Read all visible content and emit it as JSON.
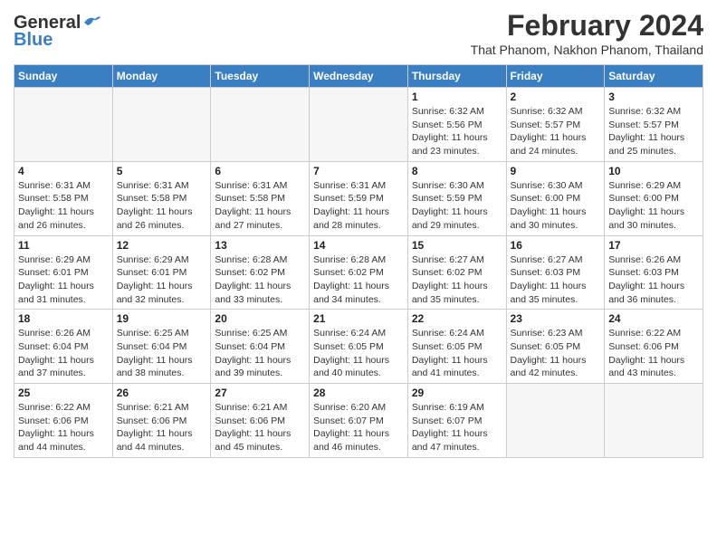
{
  "header": {
    "logo_general": "General",
    "logo_blue": "Blue",
    "title": "February 2024",
    "subtitle": "That Phanom, Nakhon Phanom, Thailand"
  },
  "days_of_week": [
    "Sunday",
    "Monday",
    "Tuesday",
    "Wednesday",
    "Thursday",
    "Friday",
    "Saturday"
  ],
  "weeks": [
    [
      {
        "day": "",
        "info": ""
      },
      {
        "day": "",
        "info": ""
      },
      {
        "day": "",
        "info": ""
      },
      {
        "day": "",
        "info": ""
      },
      {
        "day": "1",
        "info": "Sunrise: 6:32 AM\nSunset: 5:56 PM\nDaylight: 11 hours\nand 23 minutes."
      },
      {
        "day": "2",
        "info": "Sunrise: 6:32 AM\nSunset: 5:57 PM\nDaylight: 11 hours\nand 24 minutes."
      },
      {
        "day": "3",
        "info": "Sunrise: 6:32 AM\nSunset: 5:57 PM\nDaylight: 11 hours\nand 25 minutes."
      }
    ],
    [
      {
        "day": "4",
        "info": "Sunrise: 6:31 AM\nSunset: 5:58 PM\nDaylight: 11 hours\nand 26 minutes."
      },
      {
        "day": "5",
        "info": "Sunrise: 6:31 AM\nSunset: 5:58 PM\nDaylight: 11 hours\nand 26 minutes."
      },
      {
        "day": "6",
        "info": "Sunrise: 6:31 AM\nSunset: 5:58 PM\nDaylight: 11 hours\nand 27 minutes."
      },
      {
        "day": "7",
        "info": "Sunrise: 6:31 AM\nSunset: 5:59 PM\nDaylight: 11 hours\nand 28 minutes."
      },
      {
        "day": "8",
        "info": "Sunrise: 6:30 AM\nSunset: 5:59 PM\nDaylight: 11 hours\nand 29 minutes."
      },
      {
        "day": "9",
        "info": "Sunrise: 6:30 AM\nSunset: 6:00 PM\nDaylight: 11 hours\nand 30 minutes."
      },
      {
        "day": "10",
        "info": "Sunrise: 6:29 AM\nSunset: 6:00 PM\nDaylight: 11 hours\nand 30 minutes."
      }
    ],
    [
      {
        "day": "11",
        "info": "Sunrise: 6:29 AM\nSunset: 6:01 PM\nDaylight: 11 hours\nand 31 minutes."
      },
      {
        "day": "12",
        "info": "Sunrise: 6:29 AM\nSunset: 6:01 PM\nDaylight: 11 hours\nand 32 minutes."
      },
      {
        "day": "13",
        "info": "Sunrise: 6:28 AM\nSunset: 6:02 PM\nDaylight: 11 hours\nand 33 minutes."
      },
      {
        "day": "14",
        "info": "Sunrise: 6:28 AM\nSunset: 6:02 PM\nDaylight: 11 hours\nand 34 minutes."
      },
      {
        "day": "15",
        "info": "Sunrise: 6:27 AM\nSunset: 6:02 PM\nDaylight: 11 hours\nand 35 minutes."
      },
      {
        "day": "16",
        "info": "Sunrise: 6:27 AM\nSunset: 6:03 PM\nDaylight: 11 hours\nand 35 minutes."
      },
      {
        "day": "17",
        "info": "Sunrise: 6:26 AM\nSunset: 6:03 PM\nDaylight: 11 hours\nand 36 minutes."
      }
    ],
    [
      {
        "day": "18",
        "info": "Sunrise: 6:26 AM\nSunset: 6:04 PM\nDaylight: 11 hours\nand 37 minutes."
      },
      {
        "day": "19",
        "info": "Sunrise: 6:25 AM\nSunset: 6:04 PM\nDaylight: 11 hours\nand 38 minutes."
      },
      {
        "day": "20",
        "info": "Sunrise: 6:25 AM\nSunset: 6:04 PM\nDaylight: 11 hours\nand 39 minutes."
      },
      {
        "day": "21",
        "info": "Sunrise: 6:24 AM\nSunset: 6:05 PM\nDaylight: 11 hours\nand 40 minutes."
      },
      {
        "day": "22",
        "info": "Sunrise: 6:24 AM\nSunset: 6:05 PM\nDaylight: 11 hours\nand 41 minutes."
      },
      {
        "day": "23",
        "info": "Sunrise: 6:23 AM\nSunset: 6:05 PM\nDaylight: 11 hours\nand 42 minutes."
      },
      {
        "day": "24",
        "info": "Sunrise: 6:22 AM\nSunset: 6:06 PM\nDaylight: 11 hours\nand 43 minutes."
      }
    ],
    [
      {
        "day": "25",
        "info": "Sunrise: 6:22 AM\nSunset: 6:06 PM\nDaylight: 11 hours\nand 44 minutes."
      },
      {
        "day": "26",
        "info": "Sunrise: 6:21 AM\nSunset: 6:06 PM\nDaylight: 11 hours\nand 44 minutes."
      },
      {
        "day": "27",
        "info": "Sunrise: 6:21 AM\nSunset: 6:06 PM\nDaylight: 11 hours\nand 45 minutes."
      },
      {
        "day": "28",
        "info": "Sunrise: 6:20 AM\nSunset: 6:07 PM\nDaylight: 11 hours\nand 46 minutes."
      },
      {
        "day": "29",
        "info": "Sunrise: 6:19 AM\nSunset: 6:07 PM\nDaylight: 11 hours\nand 47 minutes."
      },
      {
        "day": "",
        "info": ""
      },
      {
        "day": "",
        "info": ""
      }
    ]
  ]
}
